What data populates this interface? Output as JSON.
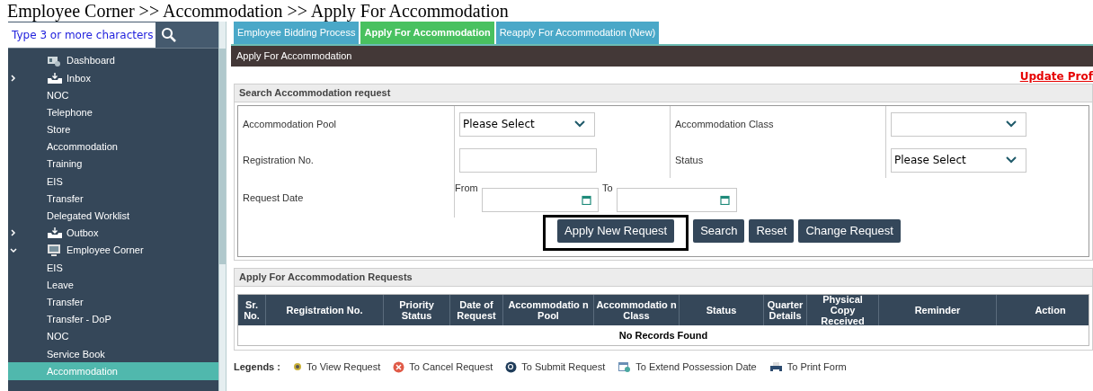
{
  "breadcrumb": "Employee Corner >> Accommodation >> Apply For Accommodation",
  "sidebar": {
    "search": {
      "placeholder": "Type 3 or more characters"
    },
    "items": [
      {
        "label": "Dashboard",
        "kind": "dashboard",
        "selected": false
      },
      {
        "label": "Inbox",
        "kind": "tray",
        "expanded": false,
        "selected": false,
        "children": [
          {
            "label": "NOC",
            "selected": false
          },
          {
            "label": "Telephone",
            "selected": false
          },
          {
            "label": "Store",
            "selected": false
          },
          {
            "label": "Accommodation",
            "selected": false
          },
          {
            "label": "Training",
            "selected": false
          },
          {
            "label": "EIS",
            "selected": false
          },
          {
            "label": "Transfer",
            "selected": false
          },
          {
            "label": "Delegated Worklist",
            "selected": false
          }
        ]
      },
      {
        "label": "Outbox",
        "kind": "tray",
        "expanded": false,
        "selected": false
      },
      {
        "label": "Employee Corner",
        "kind": "monitor",
        "expanded": true,
        "selected": false,
        "children": [
          {
            "label": "EIS",
            "selected": false
          },
          {
            "label": "Leave",
            "selected": false
          },
          {
            "label": "Transfer",
            "selected": false
          },
          {
            "label": "Transfer - DoP",
            "selected": false
          },
          {
            "label": "NOC",
            "selected": false
          },
          {
            "label": "Service Book",
            "selected": false
          },
          {
            "label": "Accommodation",
            "selected": true
          }
        ]
      }
    ]
  },
  "tabs": [
    {
      "label": "Employee Bidding Process",
      "selected": false
    },
    {
      "label": "Apply For Accommodation",
      "selected": true
    },
    {
      "label": "Reapply For Accommodation (New)",
      "selected": false
    }
  ],
  "page_title": "Apply For Accommodation",
  "update_profile_link": "Update Prof",
  "search_panel": {
    "title": "Search Accommodation request",
    "fields": [
      {
        "label": "Accommodation Pool",
        "kind": "select",
        "value": "Please Select"
      },
      {
        "label": "Accommodation Class",
        "kind": "select"
      },
      {
        "label": "Registration No.",
        "kind": "text"
      },
      {
        "label": "Status",
        "kind": "select",
        "value": "Please Select"
      }
    ],
    "request_date": {
      "label": "Request Date",
      "from_label": "From",
      "to_label": "To"
    },
    "buttons": [
      {
        "label": "Apply New Request",
        "highlighted": true
      },
      {
        "label": "Search",
        "highlighted": false
      },
      {
        "label": "Reset",
        "highlighted": false
      },
      {
        "label": "Change Request",
        "highlighted": false
      }
    ]
  },
  "requests_panel": {
    "title": "Apply For Accommodation Requests",
    "table": {
      "columns": [
        "Sr. No.",
        "Registration No.",
        "Priority Status",
        "Date of Request",
        "Accommodatio n Pool",
        "Accommodatio n Class",
        "Status",
        "Quarter Details",
        "Physical Copy Received",
        "Reminder",
        "Action"
      ],
      "empty_text": "No Records Found"
    }
  },
  "legends": {
    "label": "Legends :",
    "items": [
      {
        "label": "To View Request",
        "kind": "view"
      },
      {
        "label": "To Cancel Request",
        "kind": "cancel"
      },
      {
        "label": "To Submit Request",
        "kind": "submit"
      },
      {
        "label": "To Extend Possession Date",
        "kind": "calendar"
      },
      {
        "label": "To Print Form",
        "kind": "print"
      }
    ]
  }
}
